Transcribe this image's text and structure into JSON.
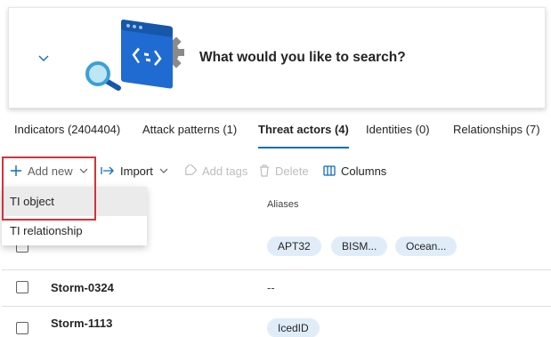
{
  "search": {
    "prompt": "What would you like to search?"
  },
  "tabs": [
    {
      "label": "Indicators (2404404)"
    },
    {
      "label": "Attack patterns (1)"
    },
    {
      "label": "Threat actors (4)",
      "active": true
    },
    {
      "label": "Identities (0)"
    },
    {
      "label": "Relationships (7)"
    }
  ],
  "toolbar": {
    "add_new": "Add new",
    "import": "Import",
    "add_tags": "Add tags",
    "delete": "Delete",
    "columns": "Columns"
  },
  "add_menu": {
    "items": [
      "TI object",
      "TI relationship"
    ]
  },
  "table": {
    "columns": {
      "aliases": "Aliases"
    },
    "rows": [
      {
        "name": "",
        "aliases": [
          "APT32",
          "BISM...",
          "Ocean..."
        ]
      },
      {
        "name": "Storm-0324",
        "aliases_text": "--"
      },
      {
        "name": "Storm-1113",
        "aliases": [
          "IcedID"
        ]
      }
    ]
  },
  "colors": {
    "accent": "#0f6cbd",
    "highlight": "#d13438",
    "pill": "#e0edf9"
  }
}
